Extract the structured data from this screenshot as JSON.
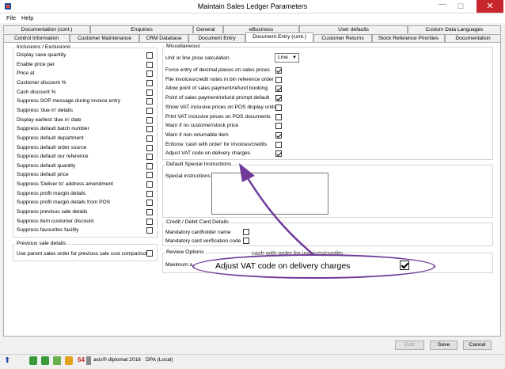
{
  "window": {
    "title": "Maintain Sales Ledger Parameters",
    "close_glyph": "✕",
    "maximize_glyph": "☐",
    "minimize_glyph": "—"
  },
  "menu": [
    "File",
    "Help"
  ],
  "tabs_row1": [
    "Documentation (cont.)",
    "Enquiries",
    "General",
    "eBusiness",
    "User defaults",
    "Custom Data Languages"
  ],
  "tabs_row2": [
    "Control Information",
    "Customer Maintenance",
    "CRM Database",
    "Document Entry",
    "Document Entry (cont.)",
    "Customer Returns",
    "Stock Reference Priorities",
    "Documentation"
  ],
  "active_tab": "Document Entry (cont.)",
  "inclusions": {
    "title": "Inclusions / Exclusions",
    "items": [
      {
        "label": "Display case quantity",
        "checked": false
      },
      {
        "label": "Enable price per",
        "checked": false
      },
      {
        "label": "Price at",
        "checked": false
      },
      {
        "label": "Customer discount %",
        "checked": false
      },
      {
        "label": "Cash discount %",
        "checked": false
      },
      {
        "label": "Suppress SOP message during invoice entry",
        "checked": false
      },
      {
        "label": "Suppress 'due in' details",
        "checked": false
      },
      {
        "label": "Display earliest 'due in' date",
        "checked": false
      },
      {
        "label": "Suppress default batch number",
        "checked": false
      },
      {
        "label": "Suppress default department",
        "checked": false
      },
      {
        "label": "Suppress default order source",
        "checked": false
      },
      {
        "label": "Suppress default our reference",
        "checked": false
      },
      {
        "label": "Suppress default quantity",
        "checked": false
      },
      {
        "label": "Suppress default price",
        "checked": false
      },
      {
        "label": "Suppress 'Deliver to' address amendment",
        "checked": false
      },
      {
        "label": "Suppress profit margin details",
        "checked": false
      },
      {
        "label": "Suppress profit margin details from POS",
        "checked": false
      },
      {
        "label": "Suppress previous sale details",
        "checked": false
      },
      {
        "label": "Suppress item customer discount",
        "checked": false
      },
      {
        "label": "Suppress favourites facility",
        "checked": false
      }
    ]
  },
  "previous_sale": {
    "title": "Previous sale details",
    "items": [
      {
        "label": "Use parent sales order for previous sale cost comparison",
        "checked": false
      }
    ]
  },
  "misc": {
    "title": "Miscellaneous",
    "unit_label": "Unit or line price calculation",
    "unit_value": "Line",
    "items": [
      {
        "label": "Force entry of decimal places on sales prices",
        "checked": true
      },
      {
        "label": "File invoices/credit notes in bin reference order",
        "checked": false
      },
      {
        "label": "Allow point of sales payment/refund booking",
        "checked": true
      },
      {
        "label": "Point of sales payment/refund prompt default",
        "checked": true
      },
      {
        "label": "Show VAT inclusive prices on POS display units",
        "checked": false
      },
      {
        "label": "Print VAT inclusive prices on POS documents",
        "checked": false
      },
      {
        "label": "Warn if no customer/stock price",
        "checked": false
      },
      {
        "label": "Warn if non-returnable item",
        "checked": true
      },
      {
        "label": "Enforce 'cash with order' for invoices/credits",
        "checked": false
      },
      {
        "label": "Adjust VAT code on delivery charges",
        "checked": true
      }
    ]
  },
  "special": {
    "title": "Default Special Instructions",
    "label": "Special instructions"
  },
  "credit_card": {
    "title": "Credit / Debit Card Details",
    "items": [
      {
        "label": "Mandatory cardholder name",
        "checked": false
      },
      {
        "label": "Mandatory card verification code",
        "checked": false
      }
    ]
  },
  "review": {
    "title": "Review Options",
    "label": "Maximum a"
  },
  "buttons": {
    "edit": "Edit",
    "save": "Save",
    "cancel": "Cancel"
  },
  "status": {
    "product": "axis® diplomat 2018",
    "company": "DPA (Local)"
  },
  "callout": {
    "text": "Adjust VAT code on delivery charges",
    "checked": true,
    "behind_text": "cash with order for invoices/credits"
  },
  "colors": {
    "callout": "#6f3a99",
    "close": "#c7262c"
  }
}
